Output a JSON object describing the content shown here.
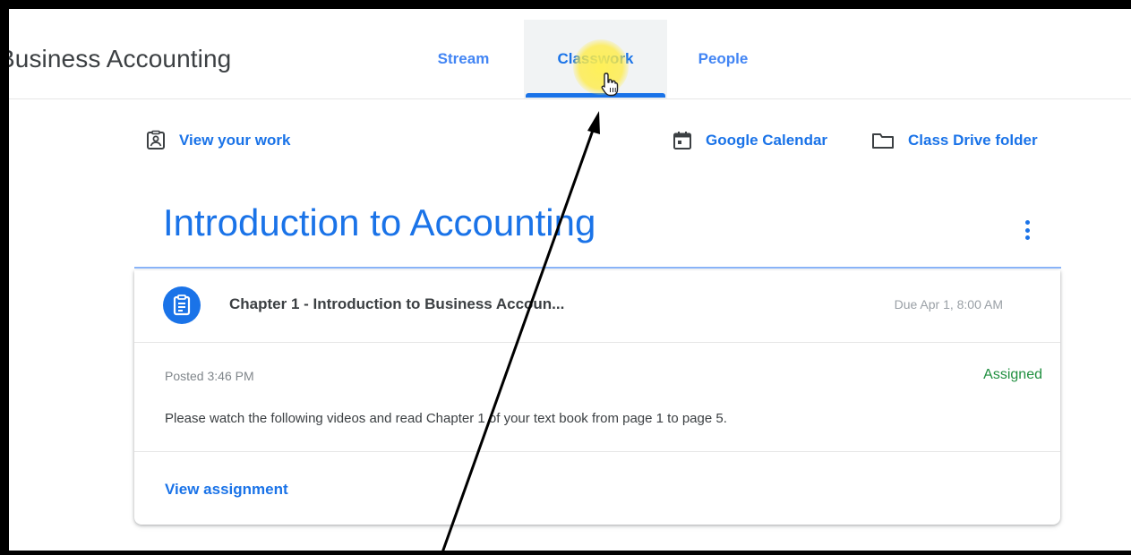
{
  "header": {
    "class_title": "Business Accounting",
    "tabs": [
      {
        "label": "Stream"
      },
      {
        "label": "Classwork",
        "active": true
      },
      {
        "label": "People"
      }
    ]
  },
  "toolbar": {
    "view_work": {
      "label": "View your work",
      "icon": "assignment-ind-icon"
    },
    "calendar": {
      "label": "Google Calendar",
      "icon": "calendar-icon"
    },
    "drive": {
      "label": "Class Drive folder",
      "icon": "folder-icon"
    }
  },
  "topic": {
    "title": "Introduction to Accounting",
    "menu_icon": "more-vert-icon"
  },
  "assignment": {
    "icon": "assignment-icon",
    "title": "Chapter 1 - Introduction to Business Accoun...",
    "due": "Due Apr 1, 8:00 AM",
    "posted": "Posted 3:46 PM",
    "status": "Assigned",
    "description": "Please watch the following videos and read Chapter 1 of your text book from page 1 to page 5.",
    "view_label": "View assignment"
  },
  "colors": {
    "accent": "#1a73e8",
    "status_green": "#1e8e3e",
    "text_dark": "#3c4043",
    "text_muted": "#80868b"
  }
}
